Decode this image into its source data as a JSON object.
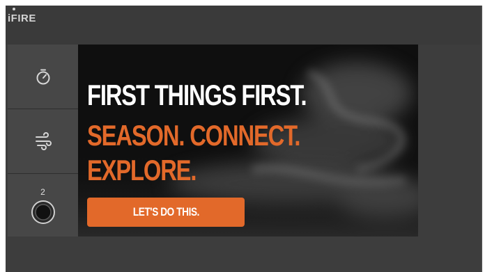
{
  "app": {
    "logo_text": "iFIRE"
  },
  "sidebar": {
    "items": [
      {
        "icon": "timer-icon"
      },
      {
        "icon": "smoke-icon"
      },
      {
        "icon": "probe-dial-icon",
        "count": "2"
      }
    ]
  },
  "banner": {
    "line1": "FIRST THINGS FIRST.",
    "line2": "SEASON. CONNECT.",
    "line3": "EXPLORE.",
    "cta_label": "LET'S DO THIS."
  },
  "colors": {
    "accent": "#e2692a",
    "background": "#3d3d3d",
    "sidebar": "#474747",
    "banner": "#0f0f0f"
  }
}
